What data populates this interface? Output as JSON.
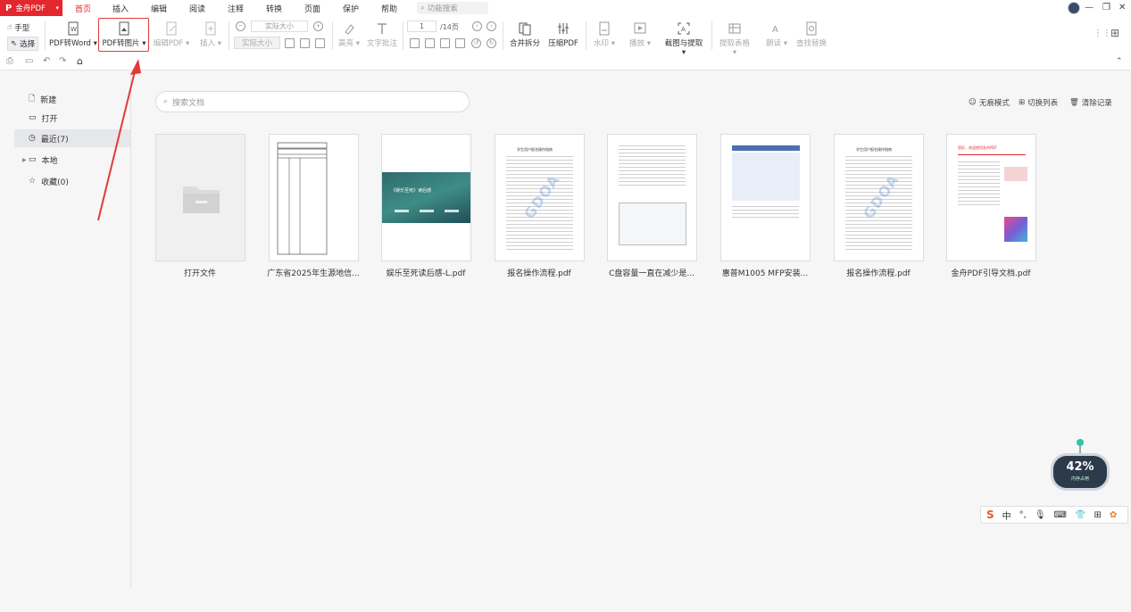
{
  "app": {
    "name": "金舟PDF",
    "menu": [
      "首页",
      "插入",
      "编辑",
      "阅读",
      "注释",
      "转换",
      "页面",
      "保护",
      "帮助"
    ],
    "function_search": "功能搜索"
  },
  "ribbon": {
    "hand": "手型",
    "select": "选择",
    "pdf_to_word": "PDF转Word",
    "pdf_to_image": "PDF转图片",
    "edit_pdf": "编辑PDF",
    "insert": "插入",
    "zoom_value": "实际大小",
    "actual_size": "实际大小",
    "highlight": "高亮",
    "text_annotation": "文字批注",
    "page_current": "1",
    "page_total": "/14页",
    "merge_split": "合并拆分",
    "compress": "压缩PDF",
    "watermark": "水印",
    "play": "播放",
    "screenshot_extract": "截图与提取",
    "extract_table": "提取表格",
    "read_aloud": "朗读",
    "find_replace": "查找替换"
  },
  "sidebar": {
    "new": "新建",
    "open": "打开",
    "recent": "最近(7)",
    "local": "本地",
    "favorites": "收藏(0)"
  },
  "main": {
    "search_placeholder": "搜索文档",
    "seamless_mode": "无痕模式",
    "switch_list": "切换列表",
    "clear_history": "清除记录",
    "files": [
      {
        "name": "打开文件"
      },
      {
        "name": "广东省2025年生源地信..."
      },
      {
        "name": "娱乐至死读后感-L.pdf",
        "cover_title": "《娱乐至死》读后感"
      },
      {
        "name": "报名操作流程.pdf",
        "doc_title": "学生用户报名操作指南",
        "watermark": "GDOA"
      },
      {
        "name": "C盘容量一直在减少是..."
      },
      {
        "name": "惠普M1005 MFP安装..."
      },
      {
        "name": "报名操作流程.pdf",
        "doc_title": "学生用户报名操作指南",
        "watermark": "GDOA"
      },
      {
        "name": "金舟PDF引导文档.pdf",
        "doc_title": "您好，欢迎使用金舟PDF"
      }
    ]
  },
  "widgets": {
    "memory_percent": "42%",
    "memory_label": "内存占用",
    "ime": {
      "chinese": "中"
    }
  },
  "colors": {
    "brand": "#e3272d",
    "highlight_box": "#e03a3a",
    "arrow": "#e53935"
  }
}
